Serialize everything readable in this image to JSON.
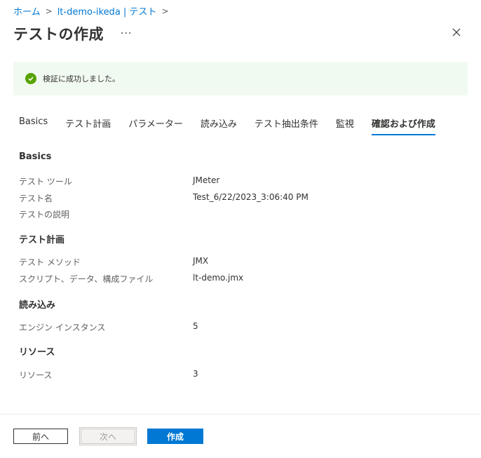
{
  "breadcrumb": {
    "items": [
      "ホーム",
      "lt-demo-ikeda | テスト"
    ],
    "separator": ">"
  },
  "header": {
    "title": "テストの作成",
    "more": "···"
  },
  "banner": {
    "message": "検証に成功しました。",
    "status_color": "#57a300"
  },
  "tabs": [
    {
      "label": "Basics"
    },
    {
      "label": "テスト計画"
    },
    {
      "label": "パラメーター"
    },
    {
      "label": "読み込み"
    },
    {
      "label": "テスト抽出条件"
    },
    {
      "label": "監視"
    },
    {
      "label": "確認および作成",
      "active": true
    }
  ],
  "sections": {
    "basics": {
      "title": "Basics",
      "rows": [
        {
          "key": "テスト ツール",
          "value": "JMeter"
        },
        {
          "key": "テスト名",
          "value": "Test_6/22/2023_3:06:40 PM"
        },
        {
          "key": "テストの説明",
          "value": ""
        }
      ]
    },
    "plan": {
      "title": "テスト計画",
      "rows": [
        {
          "key": "テスト メソッド",
          "value": "JMX"
        },
        {
          "key": "スクリプト、データ、構成ファイル",
          "value": "lt-demo.jmx"
        }
      ]
    },
    "load": {
      "title": "読み込み",
      "rows": [
        {
          "key": "エンジン インスタンス",
          "value": "5"
        }
      ]
    },
    "resources": {
      "title": "リソース",
      "rows": [
        {
          "key": "リソース",
          "value": "3"
        }
      ]
    }
  },
  "footer": {
    "prev_label": "前へ",
    "next_label": "次へ",
    "create_label": "作成"
  },
  "colors": {
    "accent": "#0078d4",
    "banner_bg": "#f1faf0"
  }
}
